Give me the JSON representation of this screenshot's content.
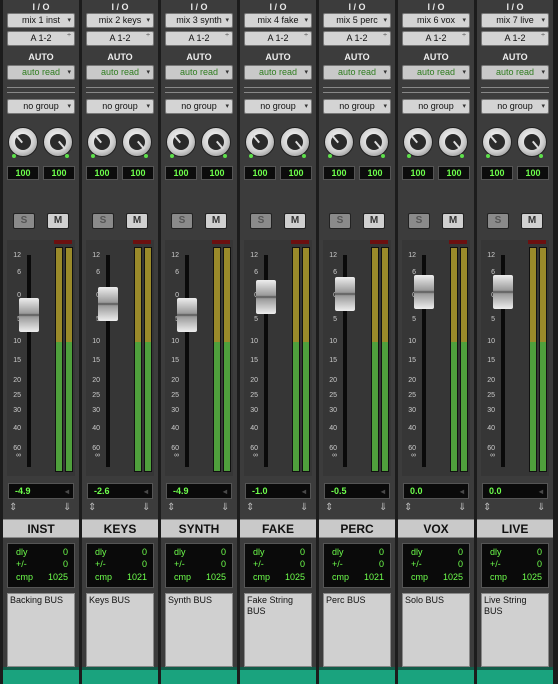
{
  "section_label": "I / O",
  "automation_header": "AUTO",
  "solo_label": "S",
  "mute_label": "M",
  "delay_labels": {
    "dly": "dly",
    "offset": "+/-",
    "cmp": "cmp"
  },
  "meter_scale": [
    "12",
    "6",
    "0",
    "5",
    "10",
    "15",
    "20",
    "25",
    "30",
    "40",
    "60",
    "∞"
  ],
  "meter_ticks": [
    "0",
    "5",
    "10",
    "15",
    "20",
    "25",
    "30",
    "35",
    "40",
    "50",
    "60"
  ],
  "colors": {
    "accent_green": "#6eff4c",
    "footer_teal": "#1aa37e",
    "meter_green": "#4fa03c",
    "meter_amber": "#9a8a2a"
  },
  "channels": [
    {
      "input": "mix 1 inst",
      "output": "A 1-2",
      "automation": "auto read",
      "group": "no group",
      "pan_left": "100",
      "pan_right": "100",
      "volume": "-4.9",
      "name": "INST",
      "dly": "0",
      "offset": "0",
      "cmp": "1025",
      "comment": "Backing BUS",
      "fader_db": -4.9
    },
    {
      "input": "mix 2 keys",
      "output": "A 1-2",
      "automation": "auto read",
      "group": "no group",
      "pan_left": "100",
      "pan_right": "100",
      "volume": "-2.6",
      "name": "KEYS",
      "dly": "0",
      "offset": "0",
      "cmp": "1021",
      "comment": "Keys BUS",
      "fader_db": -2.6
    },
    {
      "input": "mix 3 synth",
      "output": "A 1-2",
      "automation": "auto read",
      "group": "no group",
      "pan_left": "100",
      "pan_right": "100",
      "volume": "-4.9",
      "name": "SYNTH",
      "dly": "0",
      "offset": "0",
      "cmp": "1025",
      "comment": "Synth BUS",
      "fader_db": -4.9
    },
    {
      "input": "mix 4 fake",
      "output": "A 1-2",
      "automation": "auto read",
      "group": "no group",
      "pan_left": "100",
      "pan_right": "100",
      "volume": "-1.0",
      "name": "FAKE",
      "dly": "0",
      "offset": "0",
      "cmp": "1025",
      "comment": "Fake String BUS",
      "fader_db": -1.0
    },
    {
      "input": "mix 5 perc",
      "output": "A 1-2",
      "automation": "auto read",
      "group": "no group",
      "pan_left": "100",
      "pan_right": "100",
      "volume": "-0.5",
      "name": "PERC",
      "dly": "0",
      "offset": "0",
      "cmp": "1021",
      "comment": "Perc BUS",
      "fader_db": -0.5
    },
    {
      "input": "mix 6 vox",
      "output": "A 1-2",
      "automation": "auto read",
      "group": "no group",
      "pan_left": "100",
      "pan_right": "100",
      "volume": "0.0",
      "name": "VOX",
      "dly": "0",
      "offset": "0",
      "cmp": "1025",
      "comment": "Solo BUS",
      "fader_db": 0.0
    },
    {
      "input": "mix 7 live",
      "output": "A 1-2",
      "automation": "auto read",
      "group": "no group",
      "pan_left": "100",
      "pan_right": "100",
      "volume": "0.0",
      "name": "LIVE",
      "dly": "0",
      "offset": "0",
      "cmp": "1025",
      "comment": "Live String BUS",
      "fader_db": 0.0
    }
  ]
}
